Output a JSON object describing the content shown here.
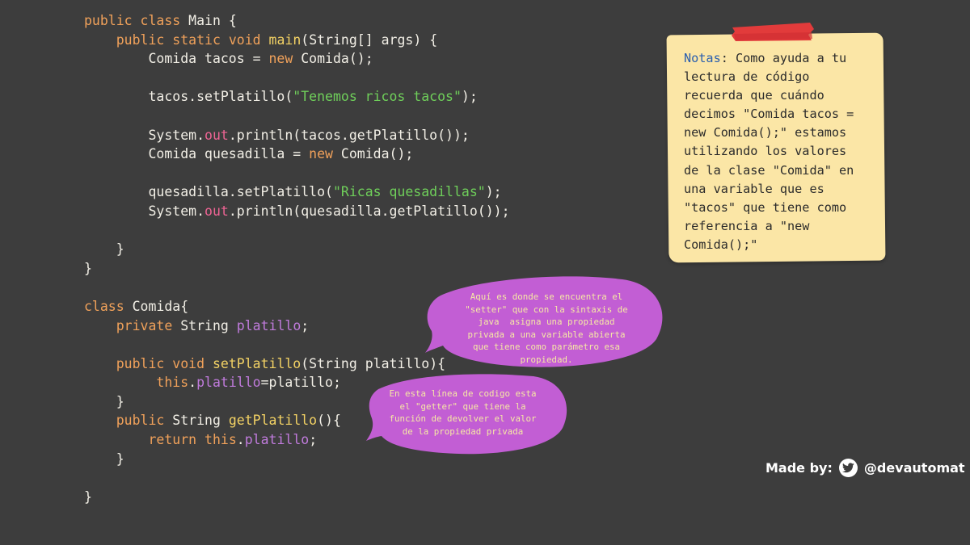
{
  "code": {
    "lines": [
      [
        [
          "kw",
          "public "
        ],
        [
          "kw",
          "class "
        ],
        [
          "t",
          "Main {"
        ]
      ],
      [
        [
          "t",
          "    "
        ],
        [
          "kw",
          "public "
        ],
        [
          "kw",
          "static "
        ],
        [
          "kw",
          "void "
        ],
        [
          "fn",
          "main"
        ],
        [
          "t",
          "(String[] args) {"
        ]
      ],
      [
        [
          "t",
          "        Comida tacos = "
        ],
        [
          "kw",
          "new "
        ],
        [
          "t",
          "Comida();"
        ]
      ],
      [],
      [
        [
          "t",
          "        tacos.setPlatillo("
        ],
        [
          "st",
          "\"Tenemos ricos tacos\""
        ],
        [
          "t",
          ");"
        ]
      ],
      [],
      [
        [
          "t",
          "        System."
        ],
        [
          "pk",
          "out"
        ],
        [
          "t",
          ".println(tacos.getPlatillo());"
        ]
      ],
      [
        [
          "t",
          "        Comida quesadilla = "
        ],
        [
          "kw",
          "new "
        ],
        [
          "t",
          "Comida();"
        ]
      ],
      [],
      [
        [
          "t",
          "        quesadilla.setPlatillo("
        ],
        [
          "st",
          "\"Ricas quesadillas\""
        ],
        [
          "t",
          ");"
        ]
      ],
      [
        [
          "t",
          "        System."
        ],
        [
          "pk",
          "out"
        ],
        [
          "t",
          ".println(quesadilla.getPlatillo());"
        ]
      ],
      [],
      [
        [
          "t",
          "    }"
        ]
      ],
      [
        [
          "t",
          "}"
        ]
      ],
      [],
      [
        [
          "kw",
          "class "
        ],
        [
          "t",
          "Comida{"
        ]
      ],
      [
        [
          "t",
          "    "
        ],
        [
          "kw",
          "private "
        ],
        [
          "t",
          "String "
        ],
        [
          "fd",
          "platillo"
        ],
        [
          "t",
          ";"
        ]
      ],
      [],
      [
        [
          "t",
          "    "
        ],
        [
          "kw",
          "public "
        ],
        [
          "kw",
          "void "
        ],
        [
          "fn",
          "setPlatillo"
        ],
        [
          "t",
          "(String platillo){"
        ]
      ],
      [
        [
          "t",
          "         "
        ],
        [
          "kw",
          "this"
        ],
        [
          "t",
          "."
        ],
        [
          "fd",
          "platillo"
        ],
        [
          "t",
          "=platillo;"
        ]
      ],
      [
        [
          "t",
          "    }"
        ]
      ],
      [
        [
          "t",
          "    "
        ],
        [
          "kw",
          "public "
        ],
        [
          "t",
          "String "
        ],
        [
          "fn",
          "getPlatillo"
        ],
        [
          "t",
          "(){"
        ]
      ],
      [
        [
          "t",
          "        "
        ],
        [
          "kw",
          "return "
        ],
        [
          "kw",
          "this"
        ],
        [
          "t",
          "."
        ],
        [
          "fd",
          "platillo"
        ],
        [
          "t",
          ";"
        ]
      ],
      [
        [
          "t",
          "    }"
        ]
      ],
      [],
      [
        [
          "t",
          "}"
        ]
      ]
    ]
  },
  "note": {
    "label": "Notas",
    "text": ": Como ayuda a tu\nlectura de código\nrecuerda que cuándo\ndecimos \"Comida tacos =\nnew Comida();\" estamos\nutilizando los valores\nde la clase \"Comida\" en\nuna variable que es\n\"tacos\" que tiene como\nreferencia a \"new\nComida();\""
  },
  "bubbles": {
    "setter": "Aquí es donde se encuentra el\n\"setter\" que con la sintaxis de\njava  asigna una propiedad\nprivada a una variable abierta\nque tiene como parámetro esa\npropiedad.",
    "getter": "En esta línea de codigo esta\nel \"getter\" que tiene la\nfunción de devolver el valor\nde la propiedad privada"
  },
  "credits": {
    "made_by": "Made by:",
    "handle": "@devautomat",
    "icon": "twitter-icon"
  },
  "colors": {
    "background": "#3d3d3d",
    "keyword": "#f0a15a",
    "function": "#f3d264",
    "string": "#6fcf5a",
    "field": "#c07bdc",
    "static_field": "#ee6494",
    "note": "#fbe6a6",
    "tape": "#e23b3b",
    "bubble": "#c25ed4"
  }
}
